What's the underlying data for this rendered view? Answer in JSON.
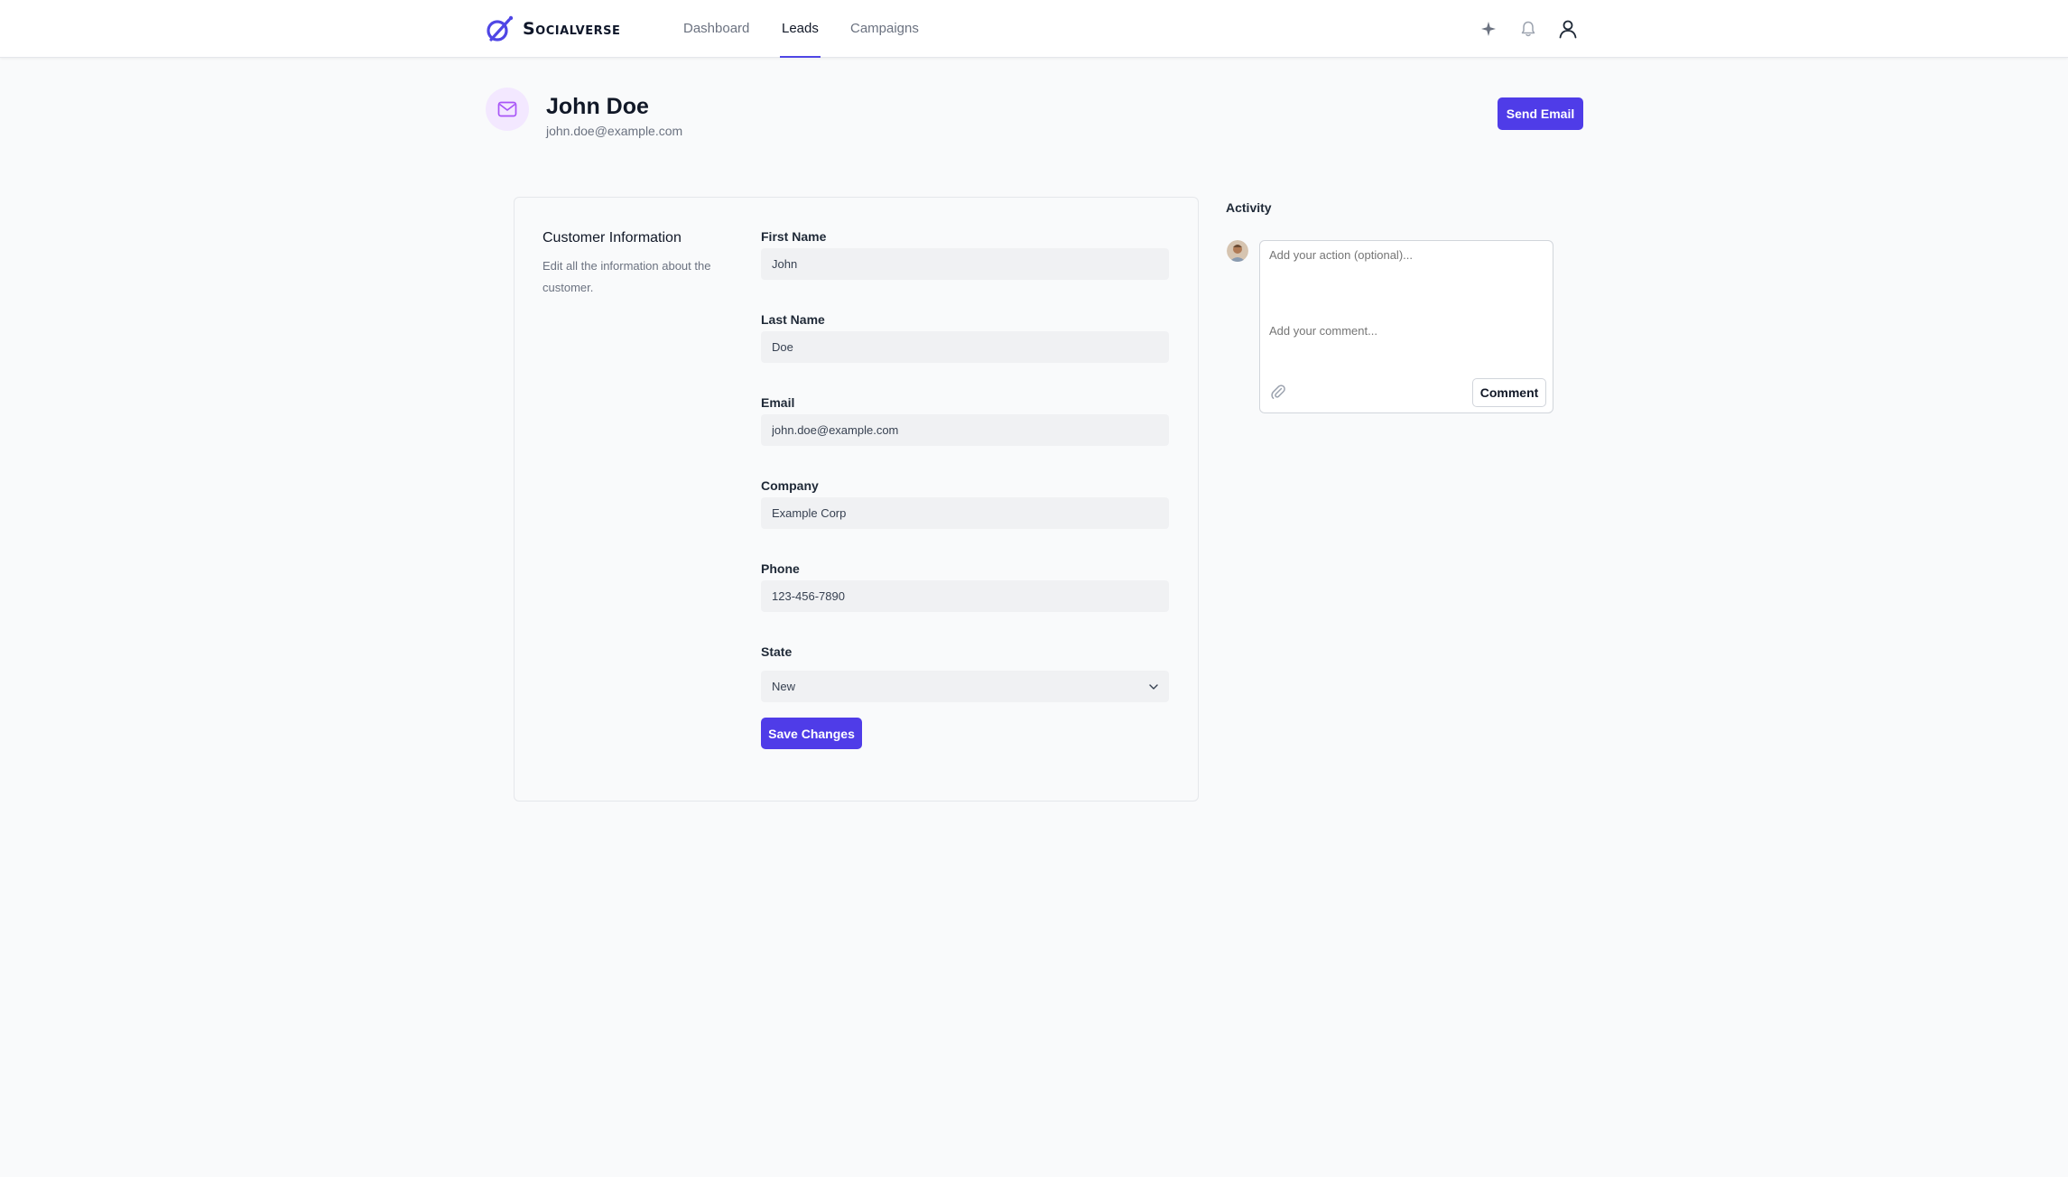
{
  "app": {
    "brand": "Socialverse",
    "brand_color": "#4f46e5"
  },
  "nav": {
    "links": [
      {
        "label": "Dashboard",
        "active": false
      },
      {
        "label": "Leads",
        "active": true
      },
      {
        "label": "Campaigns",
        "active": false
      }
    ],
    "icons": [
      "sparkle-icon",
      "bell-icon",
      "user-icon"
    ]
  },
  "lead": {
    "name": "John Doe",
    "email": "john.doe@example.com",
    "send_email_label": "Send Email"
  },
  "customer_info": {
    "title": "Customer Information",
    "description": "Edit all the information about the customer.",
    "fields": [
      {
        "label": "First Name",
        "value": "John"
      },
      {
        "label": "Last Name",
        "value": "Doe"
      },
      {
        "label": "Email",
        "value": "john.doe@example.com"
      },
      {
        "label": "Company",
        "value": "Example Corp"
      },
      {
        "label": "Phone",
        "value": "123-456-7890"
      }
    ],
    "state": {
      "label": "State",
      "value": "New"
    },
    "save_label": "Save Changes"
  },
  "activity": {
    "title": "Activity",
    "action_placeholder": "Add your action (optional)...",
    "comment_placeholder": "Add your comment...",
    "comment_button_label": "Comment"
  }
}
